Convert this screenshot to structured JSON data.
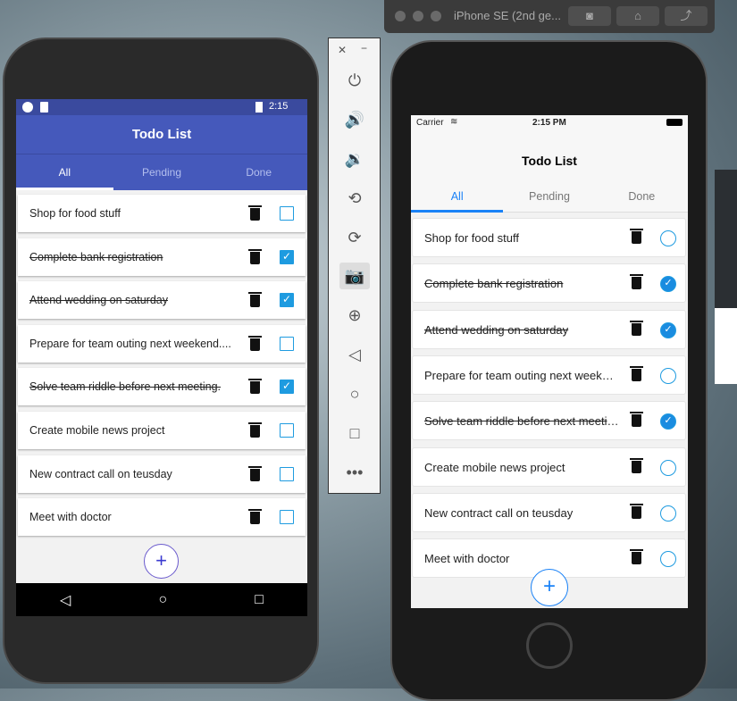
{
  "android": {
    "status_time": "2:15",
    "title": "Todo List",
    "tabs": [
      {
        "label": "All"
      },
      {
        "label": "Pending"
      },
      {
        "label": "Done"
      }
    ],
    "active_tab": "All",
    "items": [
      {
        "text": "Shop for food stuff",
        "done": false
      },
      {
        "text": "Complete bank registration",
        "done": true
      },
      {
        "text": "Attend wedding on saturday",
        "done": true
      },
      {
        "text": "Prepare for team outing next weekend....",
        "done": false
      },
      {
        "text": "Solve team riddle before next meeting.",
        "done": true
      },
      {
        "text": "Create mobile news project",
        "done": false
      },
      {
        "text": "New contract call on teusday",
        "done": false
      },
      {
        "text": "Meet with doctor",
        "done": false
      }
    ],
    "add_label": "+",
    "accent": "#4559bb"
  },
  "emulator_toolbar": {
    "icons": [
      "close-icon",
      "minimize-icon",
      "power-icon",
      "volume-up-icon",
      "volume-down-icon",
      "rotate-left-icon",
      "rotate-right-icon",
      "camera-icon",
      "zoom-icon",
      "back-icon",
      "home-icon",
      "overview-icon",
      "more-icon"
    ]
  },
  "ios": {
    "window_title": "iPhone SE (2nd ge...",
    "carrier": "Carrier",
    "status_time": "2:15 PM",
    "title": "Todo List",
    "tabs": [
      {
        "label": "All"
      },
      {
        "label": "Pending"
      },
      {
        "label": "Done"
      }
    ],
    "active_tab": "All",
    "items": [
      {
        "text": "Shop for food stuff",
        "done": false
      },
      {
        "text": "Complete bank registration",
        "done": true
      },
      {
        "text": "Attend wedding on saturday",
        "done": true
      },
      {
        "text": "Prepare for team outing next weekend....",
        "done": false
      },
      {
        "text": "Solve team riddle before next meeting.",
        "done": true
      },
      {
        "text": "Create mobile news project",
        "done": false
      },
      {
        "text": "New contract call on teusday",
        "done": false
      },
      {
        "text": "Meet with doctor",
        "done": false
      }
    ],
    "add_label": "+",
    "accent": "#1a82f7"
  }
}
